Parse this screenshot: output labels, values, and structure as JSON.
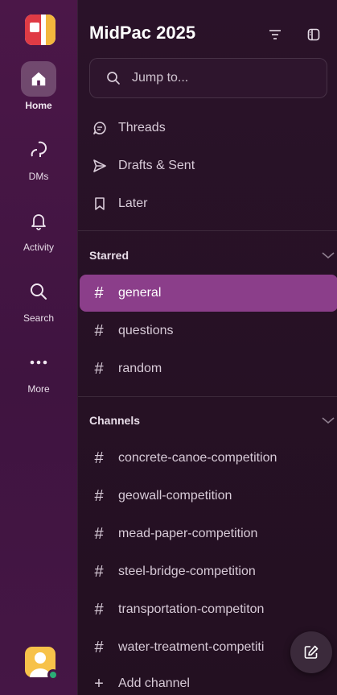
{
  "rail": {
    "items": [
      {
        "label": "Home",
        "icon": "home-icon"
      },
      {
        "label": "DMs",
        "icon": "dms-icon"
      },
      {
        "label": "Activity",
        "icon": "bell-icon"
      },
      {
        "label": "Search",
        "icon": "search-icon"
      },
      {
        "label": "More",
        "icon": "more-icon"
      }
    ]
  },
  "header": {
    "title": "MidPac 2025"
  },
  "search": {
    "placeholder": "Jump to..."
  },
  "nav": [
    {
      "label": "Threads",
      "icon": "threads-icon"
    },
    {
      "label": "Drafts & Sent",
      "icon": "send-icon"
    },
    {
      "label": "Later",
      "icon": "bookmark-icon"
    }
  ],
  "starred": {
    "label": "Starred",
    "channels": [
      "general",
      "questions",
      "random"
    ],
    "active": "general"
  },
  "channels": {
    "label": "Channels",
    "items": [
      "concrete-canoe-competition",
      "geowall-competition",
      "mead-paper-competition",
      "steel-bridge-competition",
      "transportation-competiton",
      "water-treatment-competiti"
    ],
    "add_label": "Add channel"
  },
  "colors": {
    "accent": "#8b3e8a",
    "rail": "#4b1748",
    "presence": "#2bac76"
  }
}
